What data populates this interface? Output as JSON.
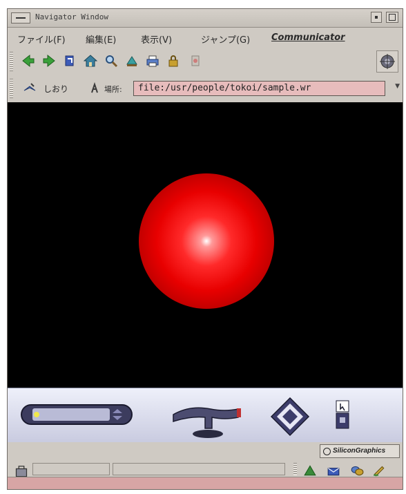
{
  "window": {
    "title": "Navigator Window"
  },
  "menu": {
    "items": [
      {
        "label": "ファイル(F)"
      },
      {
        "label": "編集(E)"
      },
      {
        "label": "表示(V)"
      },
      {
        "label": "ジャンプ(G)"
      },
      {
        "label": "Communicator"
      }
    ]
  },
  "toolbar": {
    "icons": [
      "back-icon",
      "forward-icon",
      "reload-icon",
      "home-icon",
      "search-icon",
      "guide-icon",
      "print-icon",
      "security-icon",
      "stop-icon"
    ]
  },
  "location": {
    "bookmark_label": "しおり",
    "location_label": "場所:",
    "url": "file:/usr/people/tokoi/sample.wr"
  },
  "scene": {
    "sphere_color": "#e80000",
    "background_color": "#000000"
  },
  "vrml_controls": {
    "items": [
      "slider-control-icon",
      "walk-tool-icon",
      "pan-diamond-icon",
      "viewpoint-icon"
    ]
  },
  "branding": {
    "logo_text": "SiliconGraphics"
  },
  "statusbar": {
    "status_text": ""
  }
}
